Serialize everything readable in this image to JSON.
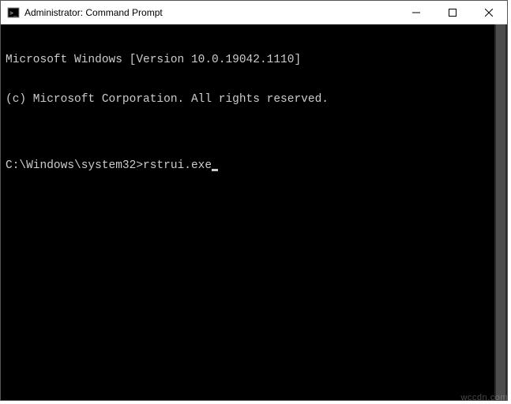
{
  "titlebar": {
    "title": "Administrator: Command Prompt",
    "icon": "cmd-icon"
  },
  "window_controls": {
    "minimize": "minimize",
    "maximize": "maximize",
    "close": "close"
  },
  "terminal": {
    "line1": "Microsoft Windows [Version 10.0.19042.1110]",
    "line2": "(c) Microsoft Corporation. All rights reserved.",
    "blank": "",
    "prompt": "C:\\Windows\\system32>",
    "command": "rstrui.exe"
  },
  "watermark": "wccdn.com"
}
